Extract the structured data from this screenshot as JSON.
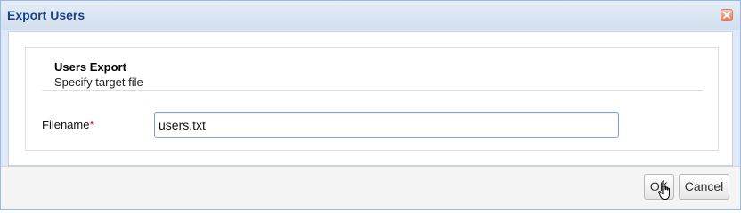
{
  "window": {
    "title": "Export Users",
    "close_icon": "close-icon"
  },
  "panel": {
    "title": "Users Export",
    "subtitle": "Specify target file"
  },
  "form": {
    "filename_label": "Filename",
    "required_marker": "*",
    "filename_value": "users.txt"
  },
  "buttons": {
    "ok_label": "OK",
    "cancel_label": "Cancel"
  },
  "colors": {
    "title_text": "#15428b",
    "window_border": "#99bbe8",
    "required": "#cc0000",
    "close_button": "#e0775a"
  }
}
